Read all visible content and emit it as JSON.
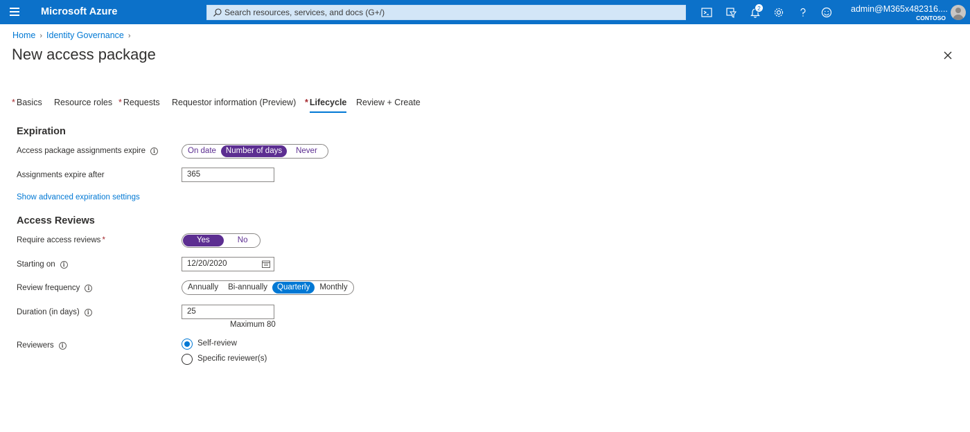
{
  "topbar": {
    "brand": "Microsoft Azure",
    "search_placeholder": "Search resources, services, and docs (G+/)",
    "notification_count": "2",
    "user_name": "admin@M365x482316....",
    "tenant": "CONTOSO",
    "icons": [
      "cloud-shell-icon",
      "directory-filter-icon",
      "notifications-icon",
      "settings-icon",
      "help-icon",
      "feedback-icon"
    ]
  },
  "breadcrumb": {
    "home": "Home",
    "identity_governance": "Identity Governance"
  },
  "page": {
    "title": "New access package"
  },
  "tabs": [
    {
      "label": "Basics",
      "required": true
    },
    {
      "label": "Resource roles",
      "required": false
    },
    {
      "label": "Requests",
      "required": true
    },
    {
      "label": "Requestor information (Preview)",
      "required": false
    },
    {
      "label": "Lifecycle",
      "required": true,
      "active": true
    },
    {
      "label": "Review + Create",
      "required": false
    }
  ],
  "expiration": {
    "heading": "Expiration",
    "assignments_expire_label": "Access package assignments expire",
    "expire_options": [
      "On date",
      "Number of days",
      "Never"
    ],
    "expire_selected": "Number of days",
    "expire_after_label": "Assignments expire after",
    "expire_after_value": "365",
    "advanced_link": "Show advanced expiration settings"
  },
  "access_reviews": {
    "heading": "Access Reviews",
    "require_label": "Require access reviews",
    "require_options": [
      "Yes",
      "No"
    ],
    "require_selected": "Yes",
    "starting_label": "Starting on",
    "starting_value": "12/20/2020",
    "frequency_label": "Review frequency",
    "frequency_options": [
      "Annually",
      "Bi-annually",
      "Quarterly",
      "Monthly"
    ],
    "frequency_selected": "Quarterly",
    "duration_label": "Duration (in days)",
    "duration_value": "25",
    "duration_hint": "Maximum 80",
    "reviewers_label": "Reviewers",
    "reviewer_options": [
      "Self-review",
      "Specific reviewer(s)"
    ],
    "reviewer_selected": "Self-review"
  },
  "colors": {
    "topbar": "#0c71c9",
    "accent": "#0078d4",
    "toggle_selected": "#5c2e91",
    "required": "#a4262c"
  }
}
